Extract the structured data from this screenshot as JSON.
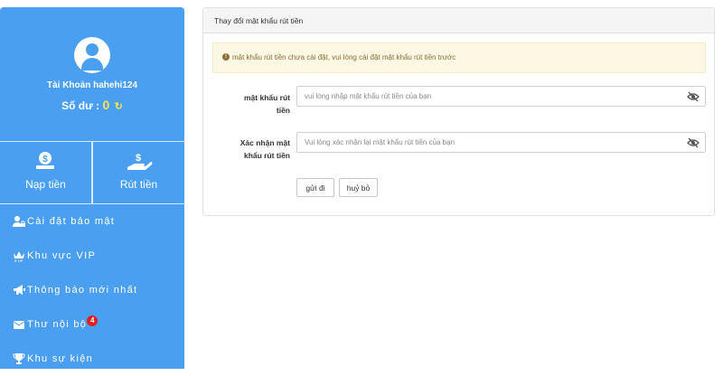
{
  "sidebar": {
    "account_label": "Tài Khoản hahehi124",
    "balance_label": "Số dư :",
    "balance_value": "0",
    "actions": {
      "deposit": "Nạp tiền",
      "withdraw": "Rút tiền"
    },
    "menu": [
      {
        "label": "Cài đặt bảo mật",
        "icon": "user-lock-icon"
      },
      {
        "label": "Khu vực VIP",
        "icon": "crown-icon"
      },
      {
        "label": "Thông báo mới nhất",
        "icon": "megaphone-icon"
      },
      {
        "label": "Thư nội bộ",
        "icon": "envelope-icon",
        "badge": "4"
      },
      {
        "label": "Khu sự kiện",
        "icon": "trophy-icon"
      }
    ],
    "colors": {
      "background": "#4a9ff0",
      "balance": "#ffe14d",
      "badge": "#e02020"
    }
  },
  "panel": {
    "title": "Thay đổi mật khẩu rút tiền",
    "alert": "mật khẩu rút tiền chưa cài đặt, vui lòng cài đặt mật khẩu rút tiền trước",
    "fields": {
      "password_label_line1": "mật khẩu rút",
      "password_label_line2": "tiền",
      "password_placeholder": "vui lòng nhập mật khẩu rút tiền của bạn",
      "confirm_label_line1": "Xác nhận mật",
      "confirm_label_line2": "khẩu rút tiền",
      "confirm_placeholder": "Vui lòng xác nhận lại mật khẩu rút tiền của bạn"
    },
    "buttons": {
      "submit": "gửi đi",
      "cancel": "huỷ bỏ"
    }
  }
}
